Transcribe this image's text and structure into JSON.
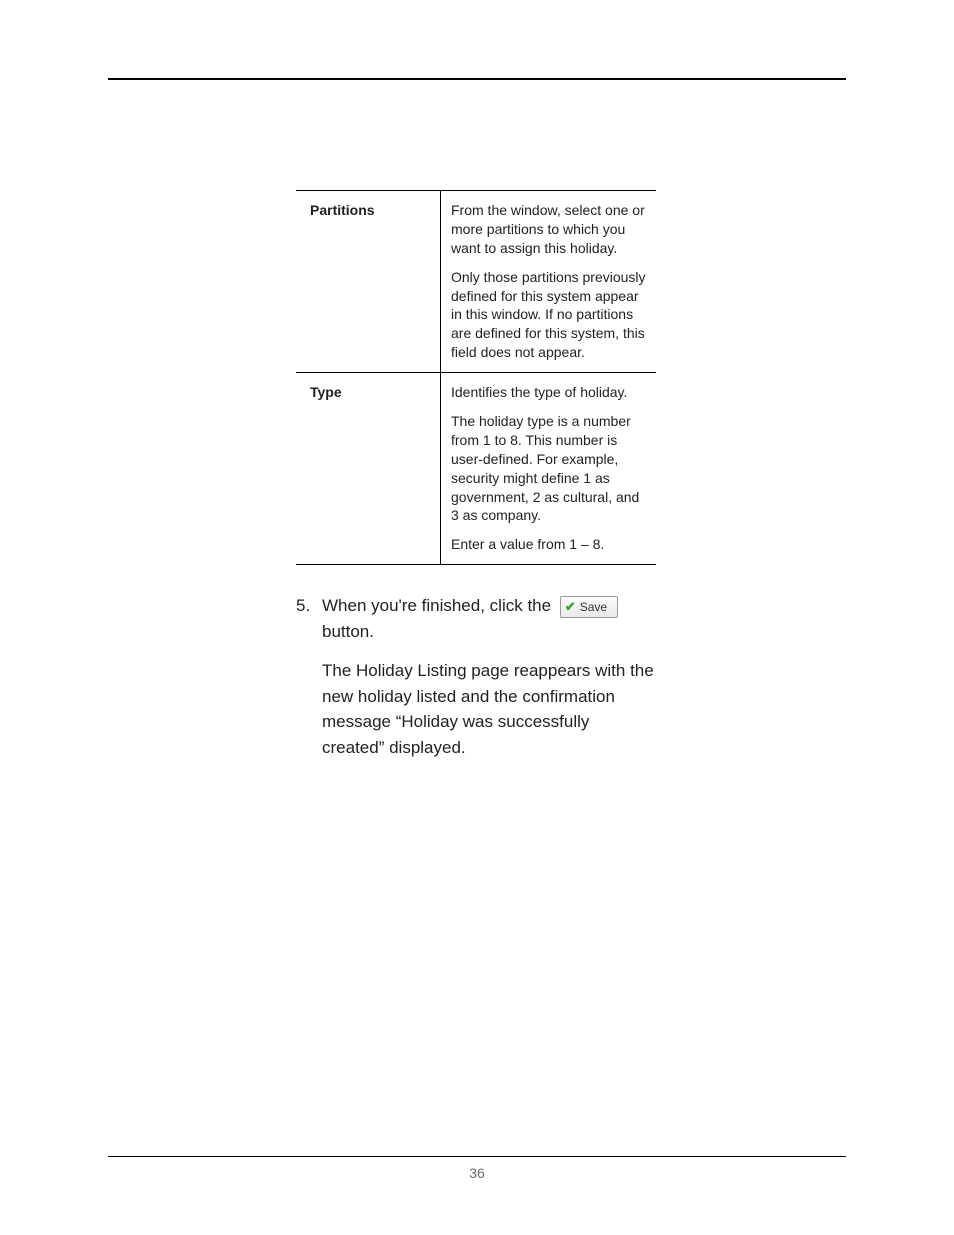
{
  "page_number": "36",
  "table": {
    "rows": [
      {
        "label": "Partitions",
        "paragraphs": [
          "From the window, select one or more partitions to which you want to assign this holiday.",
          "Only those partitions previously defined for this system appear in this window. If no partitions are defined for this system, this field does not appear."
        ]
      },
      {
        "label": "Type",
        "paragraphs": [
          "Identifies the type of holiday.",
          "The holiday type is a number from 1 to 8. This number is user-defined. For example, security might define 1 as government, 2 as cultural, and 3 as company.",
          "Enter a value from 1 – 8."
        ]
      }
    ]
  },
  "step": {
    "number": "5.",
    "line1_before": "When you're finished, click the",
    "save_button_label": "Save",
    "line1_after": "button.",
    "result": "The Holiday Listing page reappears with the new holiday listed and the confirmation message “Holiday was successfully created” displayed."
  }
}
